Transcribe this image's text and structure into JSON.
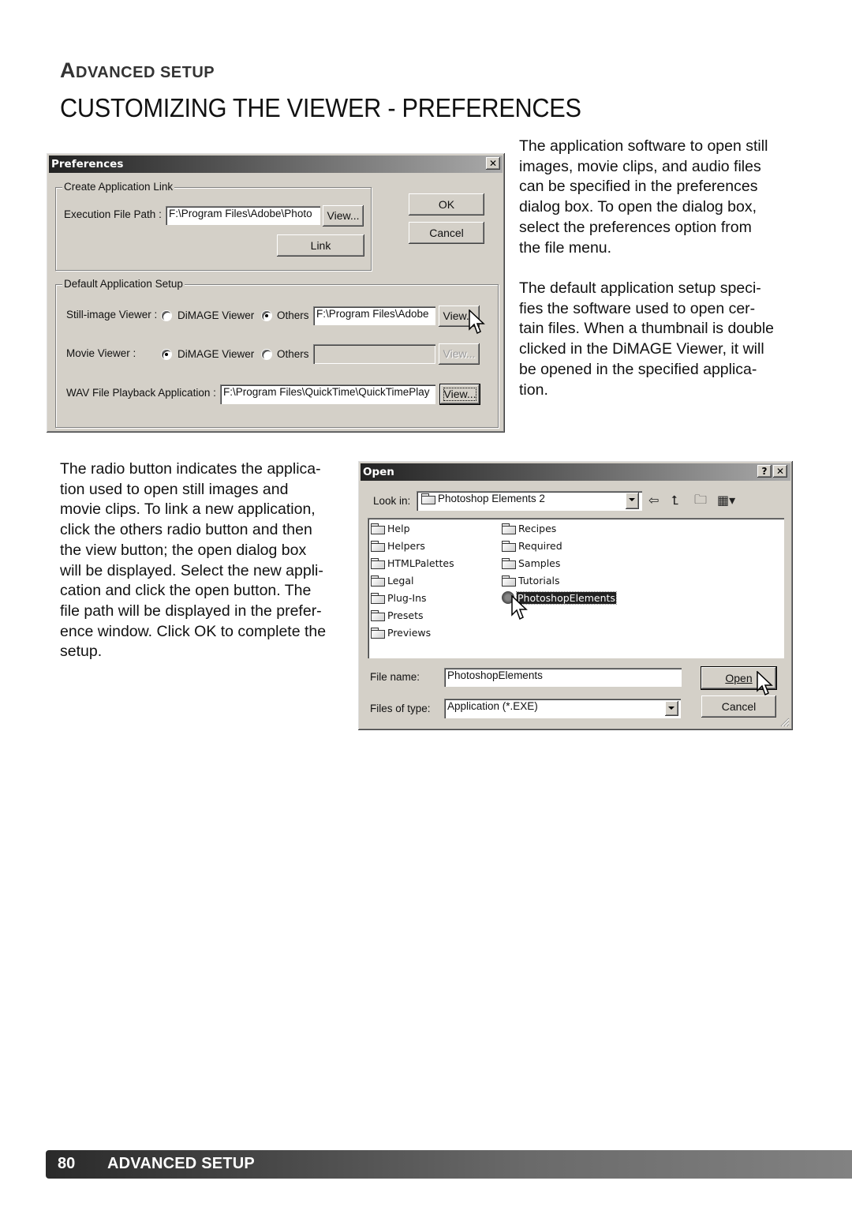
{
  "header": {
    "section_first_letter": "A",
    "section_rest": "DVANCED SETUP",
    "title": "CUSTOMIZING THE VIEWER - PREFERENCES"
  },
  "intro_text": [
    "The application software to open still",
    "images, movie clips, and audio files",
    "can be specified in the preferences",
    "dialog box. To open the dialog box,",
    "select the preferences option from",
    "the file menu."
  ],
  "default_setup_text": [
    "The default application setup speci-",
    "fies the software used to open cer-",
    "tain files. When a thumbnail is double",
    "clicked in the DiMAGE Viewer, it will",
    "be opened in the specified applica-",
    "tion."
  ],
  "radio_text": [
    "The radio button indicates the applica-",
    "tion used to open still images and",
    "movie clips. To link a new application,",
    "click the others radio button and then",
    "the view button; the open dialog box",
    "will be displayed. Select the new appli-",
    "cation and click the open button. The",
    "file path will be displayed in the prefer-",
    "ence window. Click OK to complete the",
    "setup."
  ],
  "preferences_dialog": {
    "title": "Preferences",
    "close_label": "✕",
    "create_link_group": "Create Application Link",
    "exec_path_label": "Execution File Path :",
    "exec_path_value": "F:\\Program Files\\Adobe\\Photo",
    "view_label": "View...",
    "link_label": "Link",
    "ok_label": "OK",
    "cancel_label": "Cancel",
    "default_setup_group": "Default Application Setup",
    "still_label": "Still-image Viewer :",
    "movie_label": "Movie Viewer :",
    "dimage_option": "DiMAGE Viewer",
    "others_option": "Others",
    "still_selected": "Others",
    "movie_selected": "DiMAGE Viewer",
    "still_path_value": "F:\\Program Files\\Adobe",
    "movie_path_value": "",
    "wav_label": "WAV File Playback Application :",
    "wav_path_value": "F:\\Program Files\\QuickTime\\QuickTimePlay"
  },
  "open_dialog": {
    "title": "Open",
    "help_label": "?",
    "close_label": "✕",
    "look_in_label": "Look in:",
    "look_in_value": "Photoshop Elements 2",
    "toolbar_icons": [
      "back-icon",
      "up-folder-icon",
      "new-folder-icon",
      "view-menu-icon"
    ],
    "files_left": [
      "Help",
      "Helpers",
      "HTMLPalettes",
      "Legal",
      "Plug-Ins",
      "Presets",
      "Previews"
    ],
    "files_right": [
      "Recipes",
      "Required",
      "Samples",
      "Tutorials"
    ],
    "selected_file": "PhotoshopElements",
    "file_name_label": "File name:",
    "file_name_value": "PhotoshopElements",
    "file_type_label": "Files of type:",
    "file_type_value": "Application (*.EXE)",
    "open_label": "Open",
    "cancel_label": "Cancel"
  },
  "footer": {
    "page_number": "80",
    "section": "ADVANCED SETUP"
  }
}
